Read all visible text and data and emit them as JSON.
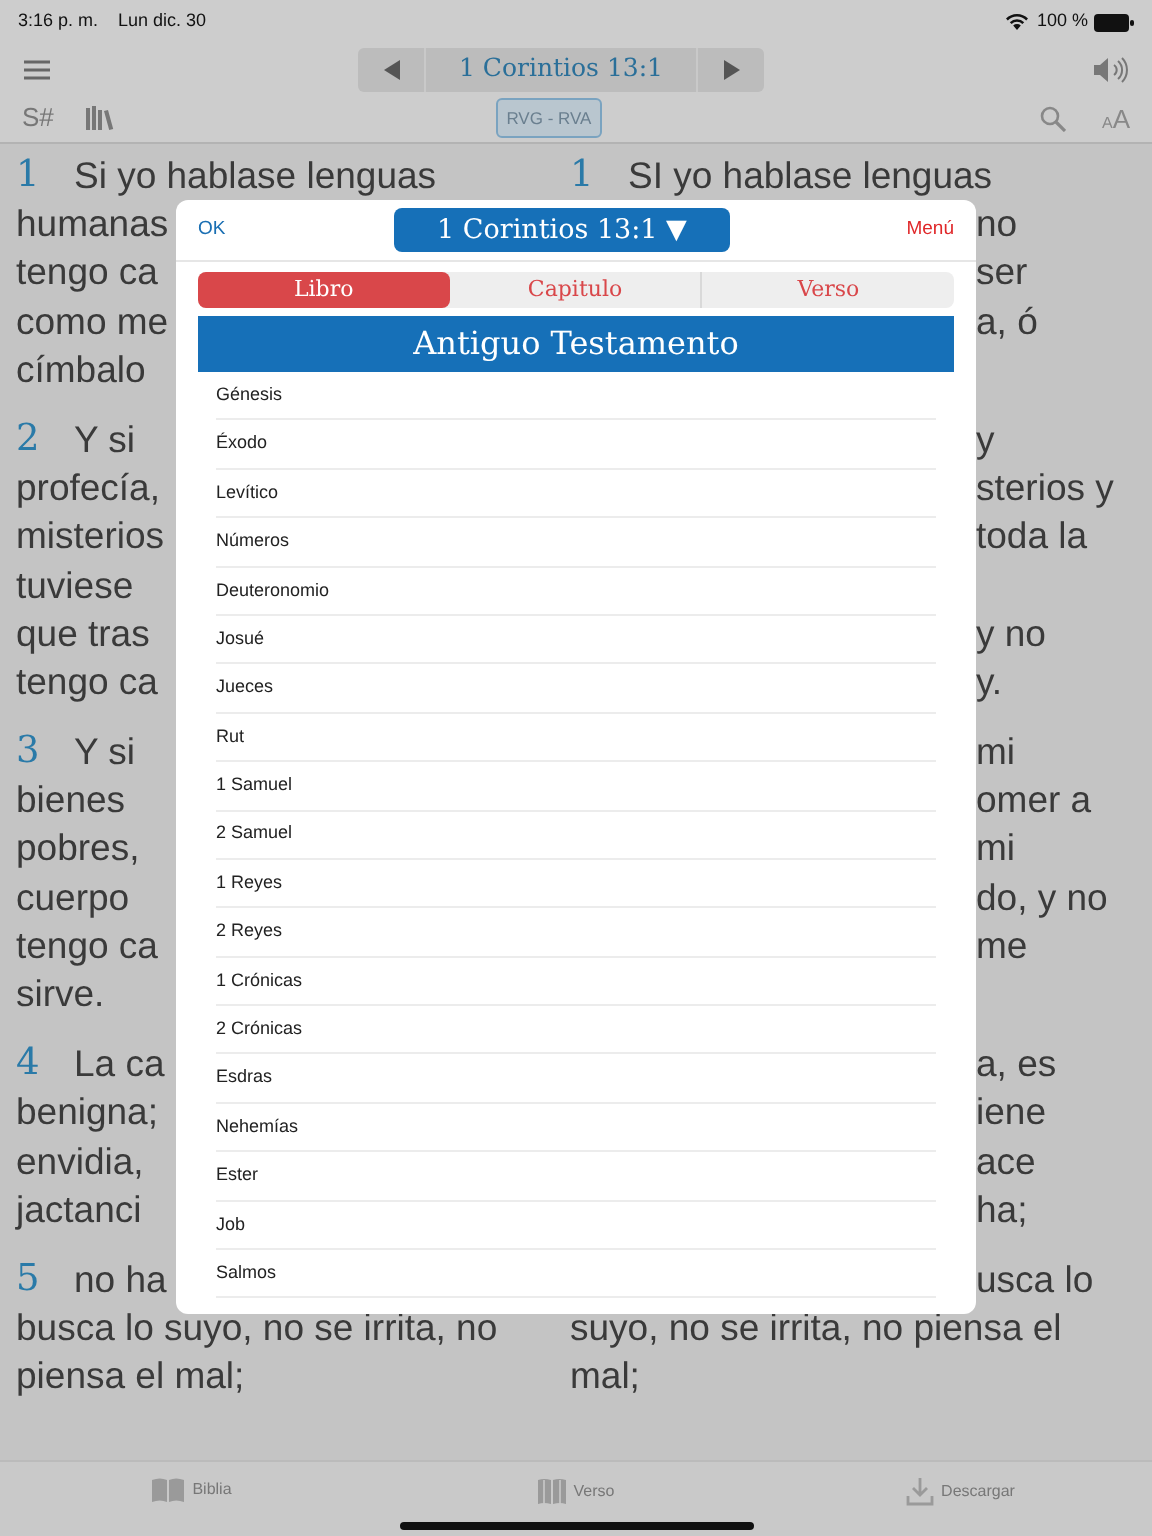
{
  "status_bar": {
    "time": "3:16 p. m.",
    "date": "Lun dic. 30",
    "battery": "100 %"
  },
  "nav_bar": {
    "reference": "1 Corintios 13:1"
  },
  "toolbar": {
    "strong_label": "S#",
    "version": "RVG - RVA",
    "text_size": {
      "small": "A",
      "large": "A"
    }
  },
  "verses": [
    {
      "rows": [
        {
          "left": {
            "number": "1",
            "text": "Si yo hablase lenguas"
          },
          "right": {
            "number": "1",
            "text": "SI yo hablase lenguas",
            "covered": false
          }
        },
        {
          "left": {
            "text": "humanas"
          },
          "right": {
            "text": "no",
            "covered": true
          }
        },
        {
          "left": {
            "text": "tengo ca"
          },
          "right": {
            "text": "ser",
            "covered": true
          }
        },
        {
          "left": {
            "text": "como me"
          },
          "right": {
            "text": "a, ó",
            "covered": true
          }
        },
        {
          "left": {
            "text": "címbalo"
          }
        }
      ]
    },
    {
      "rows": [
        {
          "left": {
            "number": "2",
            "text": "Y si"
          },
          "right": {
            "text": "y",
            "covered": true
          }
        },
        {
          "left": {
            "text": "profecía,"
          },
          "right": {
            "text": "sterios y",
            "covered": true
          }
        },
        {
          "left": {
            "text": "misterios"
          },
          "right": {
            "text": "toda la",
            "covered": true
          }
        },
        {
          "left": {
            "text": "tuviese"
          }
        },
        {
          "left": {
            "text": "que tras"
          },
          "right": {
            "text": "y no",
            "covered": true
          }
        },
        {
          "left": {
            "text": "tengo ca"
          },
          "right": {
            "text": "y.",
            "covered": true
          }
        }
      ]
    },
    {
      "rows": [
        {
          "left": {
            "number": "3",
            "text": "Y si"
          },
          "right": {
            "text": "mi",
            "covered": true
          }
        },
        {
          "left": {
            "text": "bienes"
          },
          "right": {
            "text": "omer a",
            "covered": true
          }
        },
        {
          "left": {
            "text": "pobres,"
          },
          "right": {
            "text": "mi",
            "covered": true
          }
        },
        {
          "left": {
            "text": "cuerpo"
          },
          "right": {
            "text": "do, y no",
            "covered": true
          }
        },
        {
          "left": {
            "text": "tengo ca"
          },
          "right": {
            "text": "me",
            "covered": true
          }
        },
        {
          "left": {
            "text": "sirve."
          }
        }
      ]
    },
    {
      "rows": [
        {
          "left": {
            "number": "4",
            "text": "La ca"
          },
          "right": {
            "text": "a, es",
            "covered": true
          }
        },
        {
          "left": {
            "text": "benigna;"
          },
          "right": {
            "text": "iene",
            "covered": true
          }
        },
        {
          "left": {
            "text": "envidia,"
          },
          "right": {
            "text": "ace",
            "covered": true
          }
        },
        {
          "left": {
            "text": "jactanci"
          },
          "right": {
            "text": "ha;",
            "covered": true
          }
        }
      ]
    },
    {
      "rows": [
        {
          "left": {
            "number": "5",
            "text": "no ha"
          },
          "right": {
            "text": "usca lo",
            "covered": true
          }
        },
        {
          "left": {
            "text": "busca lo suyo, no se irrita, no"
          },
          "right": {
            "text": "suyo, no se irrita, no piensa el",
            "covered": false
          }
        },
        {
          "left": {
            "text": "piensa el mal;"
          },
          "right": {
            "text": "mal;",
            "covered": false
          }
        }
      ]
    }
  ],
  "popover": {
    "ok": "OK",
    "title": "1 Corintios 13:1 ▼",
    "menu": "Menú",
    "tabs": [
      {
        "label": "Libro",
        "selected": true
      },
      {
        "label": "Capitulo",
        "selected": false
      },
      {
        "label": "Verso",
        "selected": false
      }
    ],
    "section": "Antiguo Testamento",
    "books": [
      "Génesis",
      "Éxodo",
      "Levítico",
      "Números",
      "Deuteronomio",
      "Josué",
      "Jueces",
      "Rut",
      "1 Samuel",
      "2 Samuel",
      "1 Reyes",
      "2 Reyes",
      "1 Crónicas",
      "2 Crónicas",
      "Esdras",
      "Nehemías",
      "Ester",
      "Job",
      "Salmos"
    ]
  },
  "tab_bar": [
    {
      "kind": "bible",
      "label": "Biblia"
    },
    {
      "kind": "verse",
      "label": "Verso"
    },
    {
      "kind": "download",
      "label": "Descargar"
    }
  ]
}
